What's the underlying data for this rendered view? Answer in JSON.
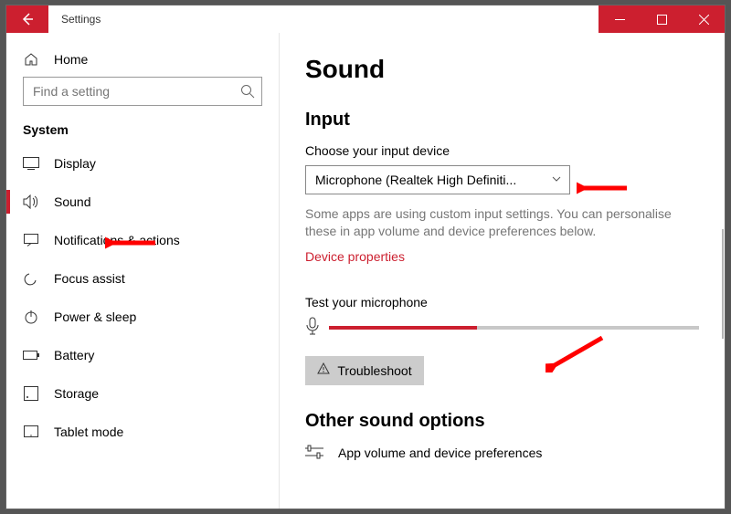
{
  "window": {
    "title": "Settings"
  },
  "sidebar": {
    "home": "Home",
    "search_placeholder": "Find a setting",
    "section": "System",
    "items": [
      {
        "label": "Display"
      },
      {
        "label": "Sound"
      },
      {
        "label": "Notifications & actions"
      },
      {
        "label": "Focus assist"
      },
      {
        "label": "Power & sleep"
      },
      {
        "label": "Battery"
      },
      {
        "label": "Storage"
      },
      {
        "label": "Tablet mode"
      }
    ]
  },
  "content": {
    "title": "Sound",
    "input_section": "Input",
    "choose_label": "Choose your input device",
    "selected_device": "Microphone (Realtek High Definiti...",
    "desc": "Some apps are using custom input settings. You can personalise these in app volume and device preferences below.",
    "device_props": "Device properties",
    "test_label": "Test your microphone",
    "mic_level_percent": 40,
    "troubleshoot": "Troubleshoot",
    "other_section": "Other sound options",
    "app_volume": "App volume and device preferences"
  }
}
